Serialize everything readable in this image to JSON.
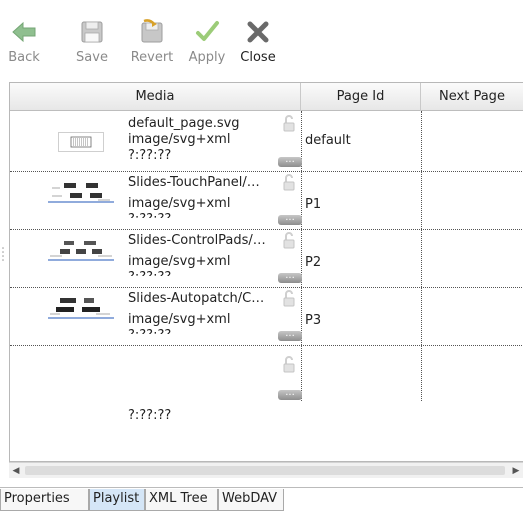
{
  "toolbar": {
    "buttons": [
      {
        "label": "Back",
        "icon": "back-arrow-icon",
        "enabled": false
      },
      {
        "label": "Save",
        "icon": "floppy-disk-icon",
        "enabled": false
      },
      {
        "label": "Revert",
        "icon": "revert-icon",
        "enabled": false
      },
      {
        "label": "Apply",
        "icon": "checkmark-icon",
        "enabled": false
      },
      {
        "label": "Close",
        "icon": "close-x-icon",
        "enabled": true
      }
    ]
  },
  "table": {
    "columns": [
      "Media",
      "Page Id",
      "Next Page"
    ],
    "rows": [
      {
        "name": "default_page.svg",
        "type": "image/svg+xml",
        "duration": "?:??:??",
        "page_id": "default",
        "next_page": ""
      },
      {
        "name": "Slides-TouchPanel/…",
        "type": "image/svg+xml",
        "duration": "?:??:??",
        "page_id": "P1",
        "next_page": ""
      },
      {
        "name": "Slides-ControlPads/…",
        "type": "image/svg+xml",
        "duration": "?:??:??",
        "page_id": "P2",
        "next_page": ""
      },
      {
        "name": "Slides-Autopatch/C…",
        "type": "image/svg+xml",
        "duration": "?:??:??",
        "page_id": "P3",
        "next_page": ""
      },
      {
        "name": "",
        "type": "",
        "duration": "?:??:??",
        "page_id": "",
        "next_page": ""
      }
    ]
  },
  "tabs": [
    "Properties",
    "Playlist",
    "XML Tree",
    "WebDAV"
  ],
  "selected_tab": "Playlist",
  "colors": {
    "back_icon": "#8fbf8f",
    "apply_icon": "#9ccc78",
    "close_icon": "#6a6a6a",
    "selected_tab_bg": "#d5e6f7"
  }
}
